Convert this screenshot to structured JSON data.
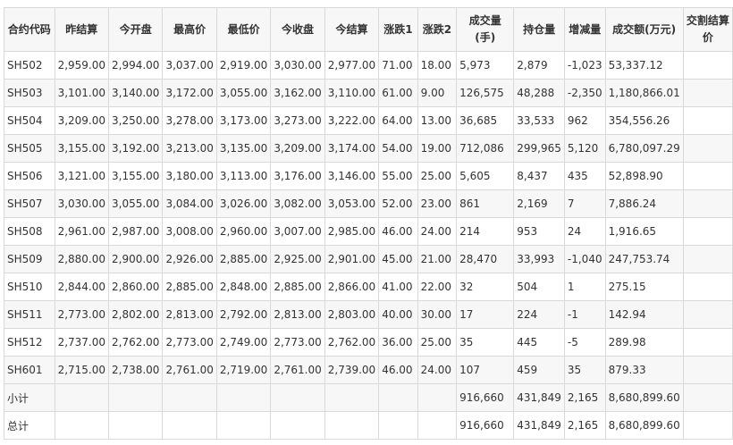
{
  "table": {
    "headers": [
      "合约代码",
      "昨结算",
      "今开盘",
      "最高价",
      "最低价",
      "今收盘",
      "今结算",
      "涨跌1",
      "涨跌2",
      "成交量(手)",
      "持仓量",
      "增减量",
      "成交额(万元)",
      "交割结算价"
    ],
    "rows": [
      [
        "SH502",
        "2,959.00",
        "2,994.00",
        "3,037.00",
        "2,919.00",
        "3,030.00",
        "2,977.00",
        "71.00",
        "18.00",
        "5,973",
        "2,879",
        "-1,023",
        "53,337.12",
        ""
      ],
      [
        "SH503",
        "3,101.00",
        "3,140.00",
        "3,172.00",
        "3,055.00",
        "3,162.00",
        "3,110.00",
        "61.00",
        "9.00",
        "126,575",
        "48,288",
        "-2,350",
        "1,180,866.01",
        ""
      ],
      [
        "SH504",
        "3,209.00",
        "3,250.00",
        "3,278.00",
        "3,173.00",
        "3,273.00",
        "3,222.00",
        "64.00",
        "13.00",
        "36,685",
        "33,533",
        "962",
        "354,556.26",
        ""
      ],
      [
        "SH505",
        "3,155.00",
        "3,192.00",
        "3,213.00",
        "3,135.00",
        "3,209.00",
        "3,174.00",
        "54.00",
        "19.00",
        "712,086",
        "299,965",
        "5,120",
        "6,780,097.29",
        ""
      ],
      [
        "SH506",
        "3,121.00",
        "3,155.00",
        "3,180.00",
        "3,113.00",
        "3,176.00",
        "3,146.00",
        "55.00",
        "25.00",
        "5,605",
        "8,437",
        "435",
        "52,898.90",
        ""
      ],
      [
        "SH507",
        "3,030.00",
        "3,055.00",
        "3,084.00",
        "3,026.00",
        "3,082.00",
        "3,053.00",
        "52.00",
        "23.00",
        "861",
        "2,169",
        "7",
        "7,886.24",
        ""
      ],
      [
        "SH508",
        "2,961.00",
        "2,987.00",
        "3,008.00",
        "2,960.00",
        "3,007.00",
        "2,985.00",
        "46.00",
        "24.00",
        "214",
        "953",
        "24",
        "1,916.65",
        ""
      ],
      [
        "SH509",
        "2,880.00",
        "2,900.00",
        "2,926.00",
        "2,885.00",
        "2,925.00",
        "2,901.00",
        "45.00",
        "21.00",
        "28,470",
        "33,993",
        "-1,040",
        "247,753.74",
        ""
      ],
      [
        "SH510",
        "2,844.00",
        "2,860.00",
        "2,885.00",
        "2,848.00",
        "2,885.00",
        "2,866.00",
        "41.00",
        "22.00",
        "32",
        "504",
        "1",
        "275.15",
        ""
      ],
      [
        "SH511",
        "2,773.00",
        "2,802.00",
        "2,813.00",
        "2,792.00",
        "2,813.00",
        "2,803.00",
        "40.00",
        "30.00",
        "17",
        "224",
        "-1",
        "142.94",
        ""
      ],
      [
        "SH512",
        "2,737.00",
        "2,762.00",
        "2,773.00",
        "2,749.00",
        "2,773.00",
        "2,762.00",
        "36.00",
        "25.00",
        "35",
        "445",
        "-5",
        "289.98",
        ""
      ],
      [
        "SH601",
        "2,715.00",
        "2,738.00",
        "2,761.00",
        "2,719.00",
        "2,761.00",
        "2,739.00",
        "46.00",
        "24.00",
        "107",
        "459",
        "35",
        "879.33",
        ""
      ]
    ],
    "subtotal": [
      "小计",
      "",
      "",
      "",
      "",
      "",
      "",
      "",
      "",
      "916,660",
      "431,849",
      "2,165",
      "8,680,899.60",
      ""
    ],
    "total": [
      "总计",
      "",
      "",
      "",
      "",
      "",
      "",
      "",
      "",
      "916,660",
      "431,849",
      "2,165",
      "8,680,899.60",
      ""
    ]
  }
}
